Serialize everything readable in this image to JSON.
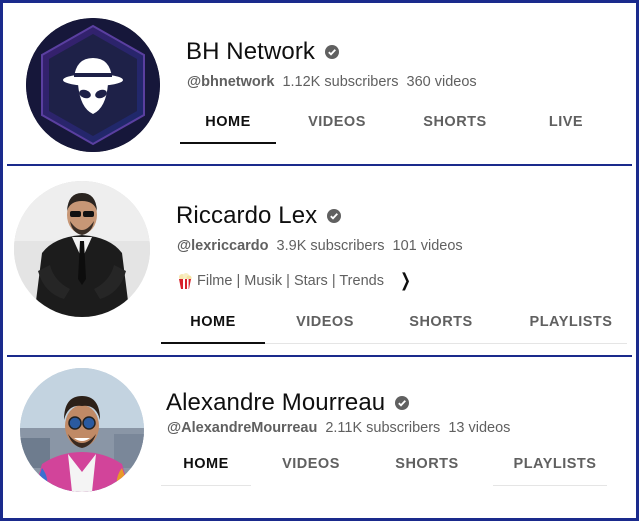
{
  "channels": [
    {
      "name": "BH Network",
      "handle": "@bhnetwork",
      "subscribers": "1.12K subscribers",
      "videos": "360 videos",
      "tabs": [
        "HOME",
        "VIDEOS",
        "SHORTS",
        "LIVE"
      ],
      "active_tab": "HOME"
    },
    {
      "name": "Riccardo Lex",
      "handle": "@lexriccardo",
      "subscribers": "3.9K subscribers",
      "videos": "101 videos",
      "tagline": "Filme | Musik | Stars | Trends",
      "tabs": [
        "HOME",
        "VIDEOS",
        "SHORTS",
        "PLAYLISTS"
      ],
      "active_tab": "HOME"
    },
    {
      "name": "Alexandre Mourreau",
      "handle": "@AlexandreMourreau",
      "subscribers": "2.11K subscribers",
      "videos": "13 videos",
      "tabs": [
        "HOME",
        "VIDEOS",
        "SHORTS",
        "PLAYLISTS"
      ],
      "active_tab": "HOME"
    }
  ],
  "icons": {
    "verified": "verified-check-icon",
    "tagline_emoji": "popcorn-icon",
    "tagline_more": "chevron-right-icon"
  },
  "colors": {
    "frame": "#1a2a8c",
    "text_primary": "#0f0f0f",
    "text_secondary": "#606060",
    "bh_avatar_bg": "#1b1c3a"
  }
}
